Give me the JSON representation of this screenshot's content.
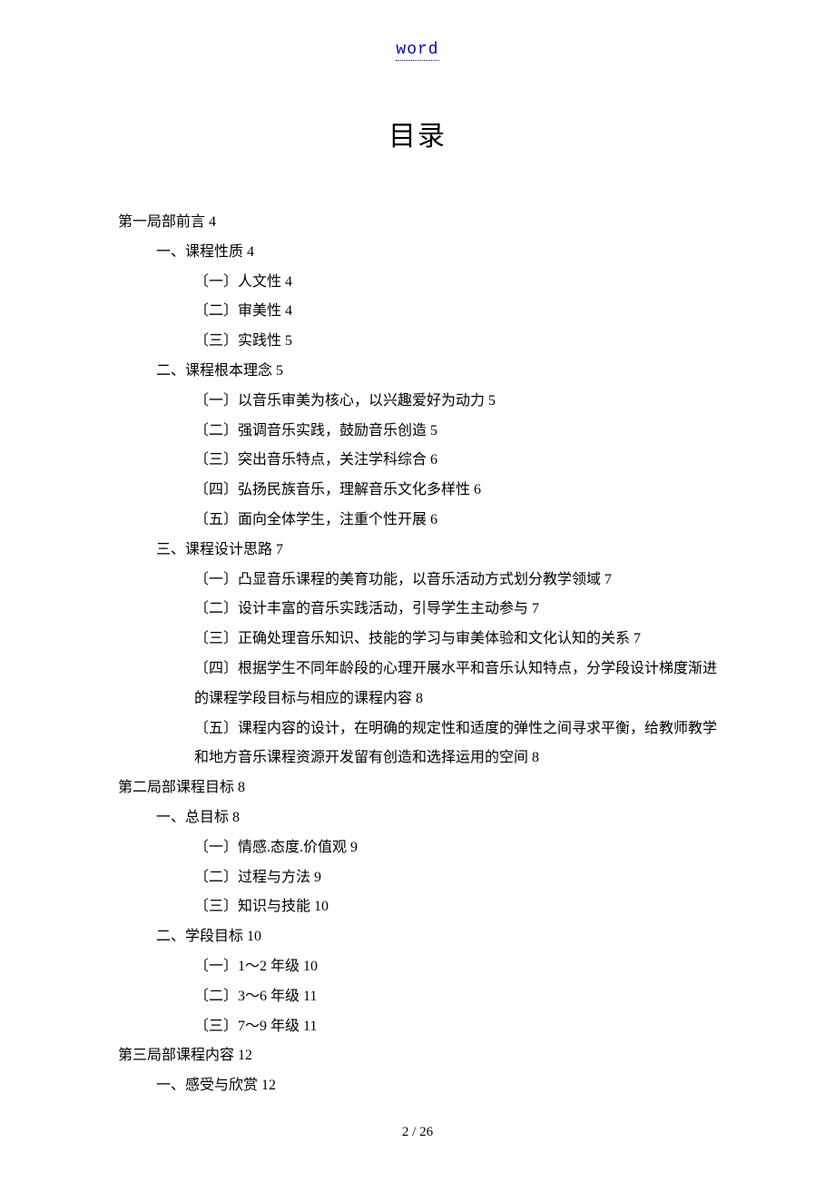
{
  "header_link": "word",
  "title": "目录",
  "toc": {
    "s1": "第一局部前言 4",
    "s1_1": "一、课程性质 4",
    "s1_1_1": "〔一〕人文性 4",
    "s1_1_2": "〔二〕审美性 4",
    "s1_1_3": "〔三〕实践性 5",
    "s1_2": "二、课程根本理念 5",
    "s1_2_1": "〔一〕以音乐审美为核心，以兴趣爱好为动力 5",
    "s1_2_2": "〔二〕强调音乐实践，鼓励音乐创造 5",
    "s1_2_3": "〔三〕突出音乐特点，关注学科综合 6",
    "s1_2_4": "〔四〕弘扬民族音乐，理解音乐文化多样性 6",
    "s1_2_5": "〔五〕面向全体学生，注重个性开展 6",
    "s1_3": "三、课程设计思路 7",
    "s1_3_1": "〔一〕凸显音乐课程的美育功能，以音乐活动方式划分教学领域 7",
    "s1_3_2": "〔二〕设计丰富的音乐实践活动，引导学生主动参与 7",
    "s1_3_3": "〔三〕正确处理音乐知识、技能的学习与审美体验和文化认知的关系 7",
    "s1_3_4": "〔四〕根据学生不同年龄段的心理开展水平和音乐认知特点，分学段设计梯度渐进的课程学段目标与相应的课程内容 8",
    "s1_3_5": "〔五〕课程内容的设计，在明确的规定性和适度的弹性之间寻求平衡，给教师教学和地方音乐课程资源开发留有创造和选择运用的空间 8",
    "s2": "第二局部课程目标 8",
    "s2_1": "一、总目标 8",
    "s2_1_1": "〔一〕情感.态度.价值观 9",
    "s2_1_2": "〔二〕过程与方法 9",
    "s2_1_3": "〔三〕知识与技能 10",
    "s2_2": "二、学段目标 10",
    "s2_2_1": "〔一〕1～2 年级 10",
    "s2_2_2": "〔二〕3～6 年级 11",
    "s2_2_3": "〔三〕7～9 年级 11",
    "s3": "第三局部课程内容 12",
    "s3_1": "一、感受与欣赏 12"
  },
  "page_number": "2 / 26"
}
